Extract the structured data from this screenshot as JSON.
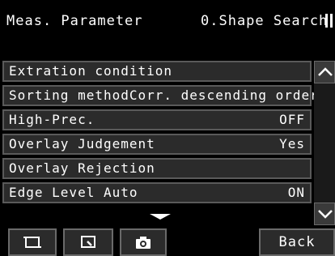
{
  "header": {
    "title": "Meas. Parameter",
    "mode": "0.Shape Search"
  },
  "rows": [
    {
      "label": "Extration condition",
      "value": ""
    },
    {
      "label": "Sorting methodCorr. descending order",
      "value": ""
    },
    {
      "label": "High-Prec.",
      "value": "OFF"
    },
    {
      "label": "Overlay Judgement",
      "value": "Yes"
    },
    {
      "label": "Overlay Rejection",
      "value": ""
    },
    {
      "label": "Edge Level Auto",
      "value": "ON"
    }
  ],
  "toolbar": {
    "back_label": "Back",
    "icons": [
      "frame-icon",
      "zoom-region-icon",
      "camera-icon"
    ]
  },
  "colors": {
    "background": "#000000",
    "row_fill": "#2b2b2b",
    "row_border": "#5a5a5a",
    "text": "#ffffff"
  }
}
